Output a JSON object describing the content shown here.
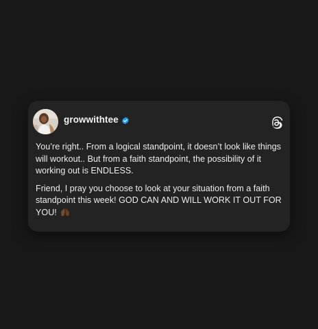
{
  "post": {
    "username": "growwithtee",
    "verified": true,
    "paragraphs": [
      "You’re right.. From a logical standpoint, it doesn’t look like things will workout.. But from a faith standpoint, the possibility of it working out is ENDLESS.",
      "Friend, I pray you choose to look at your situation from a faith standpoint this week! GOD CAN AND WILL WORK IT OUT FOR YOU!"
    ],
    "emoji": "raising-hands",
    "avatar": "profile-photo",
    "logo": "threads-logo"
  },
  "colors": {
    "background": "#181818",
    "card": "#232323",
    "text": "#ededed",
    "verified_badge": "#1d9bf0"
  }
}
